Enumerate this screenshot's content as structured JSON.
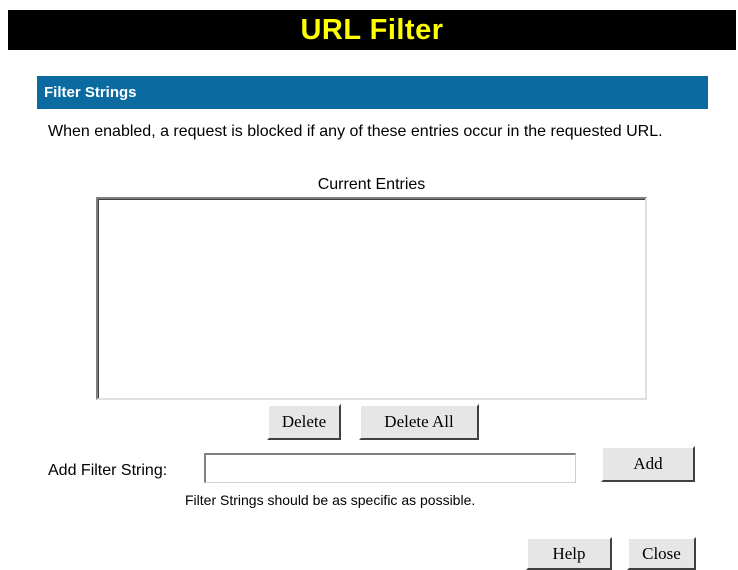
{
  "page": {
    "title": "URL Filter"
  },
  "section": {
    "header": "Filter Strings",
    "description": "When enabled, a request is blocked if any of these entries occur in the requested URL."
  },
  "entries": {
    "label": "Current Entries",
    "items": []
  },
  "buttons": {
    "delete": "Delete",
    "delete_all": "Delete All",
    "add": "Add",
    "help": "Help",
    "close": "Close"
  },
  "add_filter": {
    "label": "Add Filter String:",
    "value": "",
    "hint": "Filter Strings should be as specific as possible."
  },
  "colors": {
    "title_bar_bg": "#000000",
    "title_text": "#ffff00",
    "section_header_bg": "#0b6ba1",
    "section_header_text": "#ffffff"
  }
}
